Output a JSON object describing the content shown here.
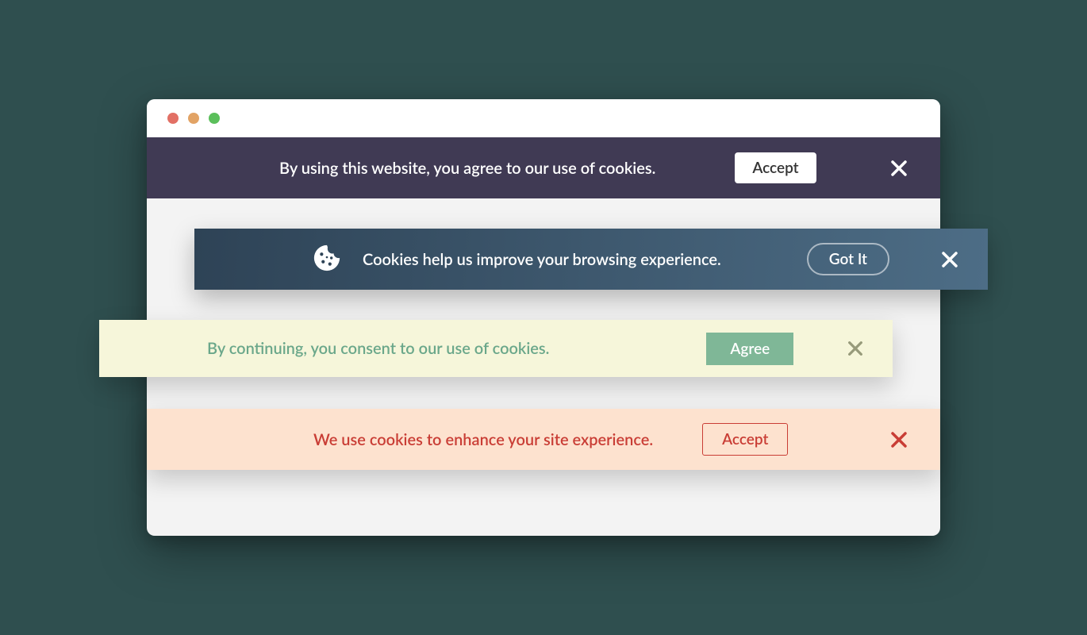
{
  "banners": [
    {
      "text": "By using this website, you agree to our use of cookies.",
      "button": "Accept"
    },
    {
      "text": "Cookies help us improve your browsing experience.",
      "button": "Got It"
    },
    {
      "text": "By continuing, you consent to our use of cookies.",
      "button": "Agree"
    },
    {
      "text": "We use cookies to enhance your site experience.",
      "button": "Accept"
    }
  ]
}
